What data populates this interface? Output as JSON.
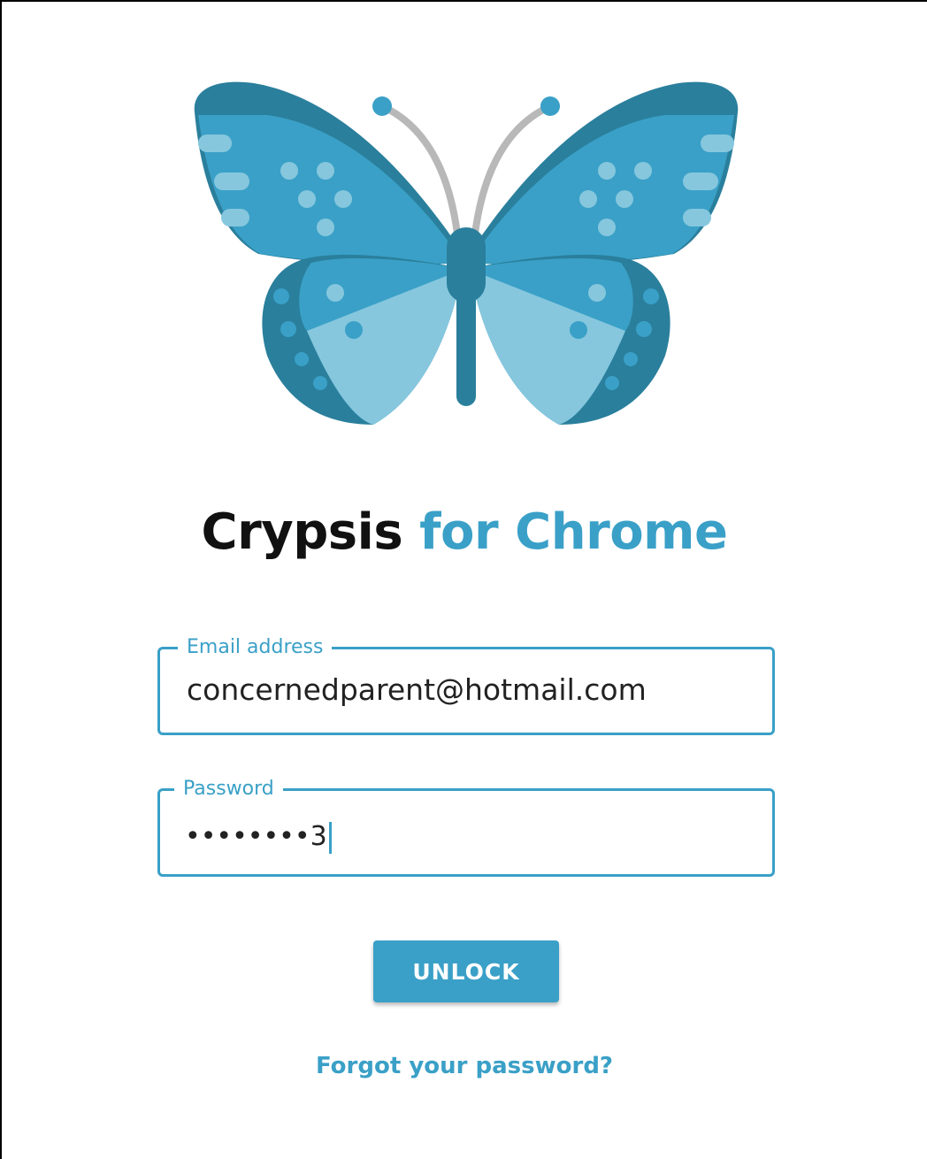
{
  "app": {
    "title_part1": "Crypsis",
    "title_part2": "for Chrome",
    "logo_icon": "butterfly-icon"
  },
  "form": {
    "email": {
      "label": "Email address",
      "value": "concernedparent@hotmail.com"
    },
    "password": {
      "label": "Password",
      "masked_value": "••••••••3"
    },
    "unlock_label": "UNLOCK",
    "forgot_label": "Forgot your password?"
  },
  "colors": {
    "accent": "#3aa0c7",
    "wing_dark": "#2a7f9c",
    "wing_light": "#86c7de",
    "antenna": "#b8b8b8",
    "title_dark": "#111111"
  }
}
